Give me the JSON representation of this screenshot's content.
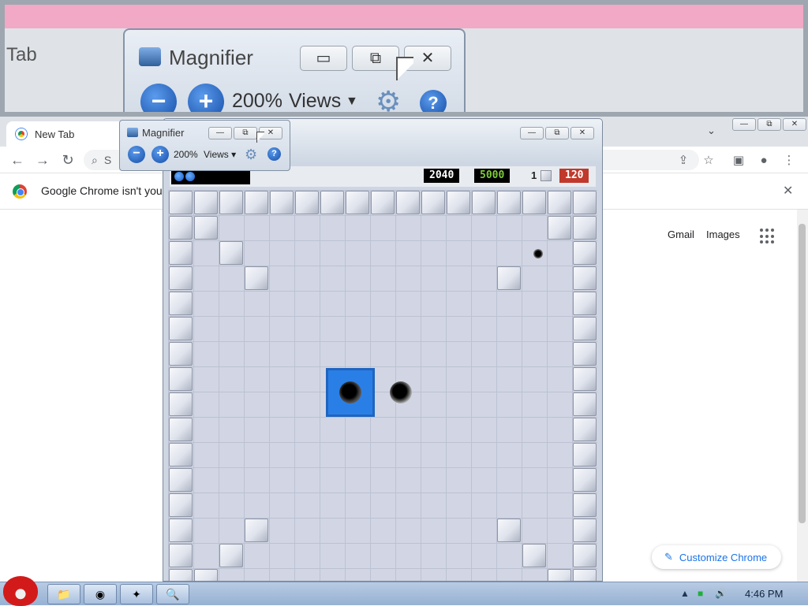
{
  "zoom_view": {
    "tab_text": "Tab",
    "magnifier": {
      "title": "Magnifier",
      "zoom_level": "200%",
      "views_label": "Views",
      "minimize": "▭",
      "restore": "⧉",
      "close": "✕"
    }
  },
  "chrome": {
    "tab_title": "New Tab",
    "tab_dropdown": "⌄",
    "window_controls": {
      "minimize": "—",
      "restore": "⧉",
      "close": "✕"
    },
    "omnibox_placeholder": "S",
    "infobar_text": "Google Chrome isn't you",
    "infobar_close": "✕",
    "links": {
      "gmail": "Gmail",
      "images": "Images"
    },
    "customize_label": "Customize Chrome",
    "nav_icons": {
      "back": "←",
      "forward": "→",
      "reload": "↻"
    },
    "toolbar_icons": {
      "share": "⇪",
      "star": "☆",
      "sidebar": "▣",
      "profile": "●",
      "menu": "⋮"
    }
  },
  "game": {
    "window_controls": {
      "minimize": "—",
      "restore": "⧉",
      "close": "✕"
    },
    "score": "2040",
    "target": "5000",
    "block_count": "1",
    "time": "120",
    "colors": {
      "target": "#7ecb3a",
      "score": "#ffffff",
      "time_bg": "#c0392b",
      "selected_hole": "#2a7fe6"
    }
  },
  "magnifier_small": {
    "title": "Magnifier",
    "zoom_level": "200%",
    "views_label": "Views ▾",
    "zoom_out": "−",
    "zoom_in": "+",
    "help": "?",
    "gear": "⚙",
    "minimize": "—",
    "restore": "⧉",
    "close": "✕"
  },
  "taskbar": {
    "time": "4:46 PM",
    "tray": {
      "expand": "▲",
      "network": "■",
      "volume": "🔊"
    },
    "buttons": [
      {
        "name": "folder",
        "glyph": "📁"
      },
      {
        "name": "chrome",
        "glyph": "◉"
      },
      {
        "name": "game",
        "glyph": "✦"
      },
      {
        "name": "magnifier",
        "glyph": "🔍"
      }
    ]
  }
}
